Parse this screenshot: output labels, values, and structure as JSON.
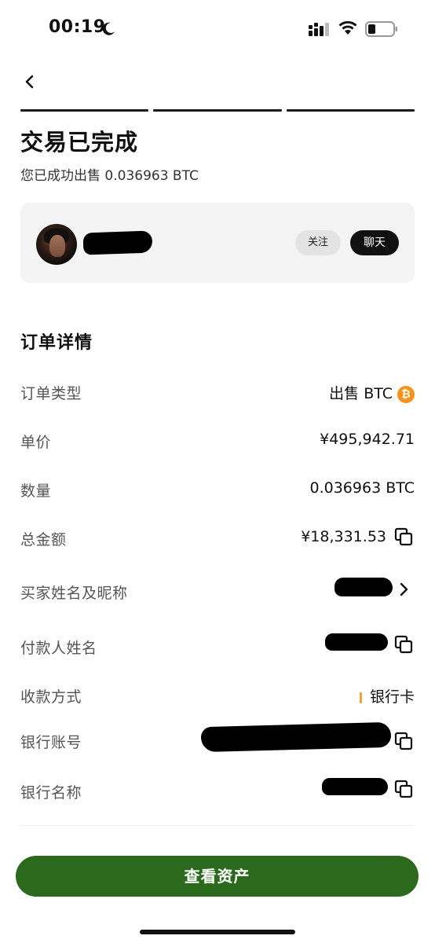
{
  "status_bar": {
    "time": "00:19",
    "icons": [
      "moon-icon",
      "signal-icon",
      "wifi-icon",
      "battery-icon"
    ]
  },
  "header": {
    "back_icon": "chevron-left-icon",
    "progress_steps": 3,
    "title": "交易已完成",
    "subtitle": "您已成功出售 0.036963 BTC"
  },
  "counterparty": {
    "follow_label": "关注",
    "chat_label": "聊天"
  },
  "order_details": {
    "title": "订单详情",
    "order_type": {
      "label": "订单类型",
      "value": "出售 BTC",
      "coin_symbol": "₿"
    },
    "unit_price": {
      "label": "单价",
      "value": "¥495,942.71"
    },
    "quantity": {
      "label": "数量",
      "value": "0.036963 BTC"
    },
    "total_amount": {
      "label": "总金额",
      "value": "¥18,331.53"
    },
    "buyer_name": {
      "label": "买家姓名及昵称"
    },
    "payer_name": {
      "label": "付款人姓名"
    },
    "payment_method": {
      "label": "收款方式",
      "value": "银行卡"
    },
    "bank_account": {
      "label": "银行账号"
    },
    "bank_name": {
      "label": "银行名称"
    }
  },
  "footer": {
    "primary_button_label": "查看资产"
  },
  "colors": {
    "accent_green": "#2b6a1c",
    "progress": "#1a1a1a",
    "card_bg": "#f4f4f4",
    "btc_orange": "#f7931a",
    "payment_bar": "#f0a040"
  }
}
